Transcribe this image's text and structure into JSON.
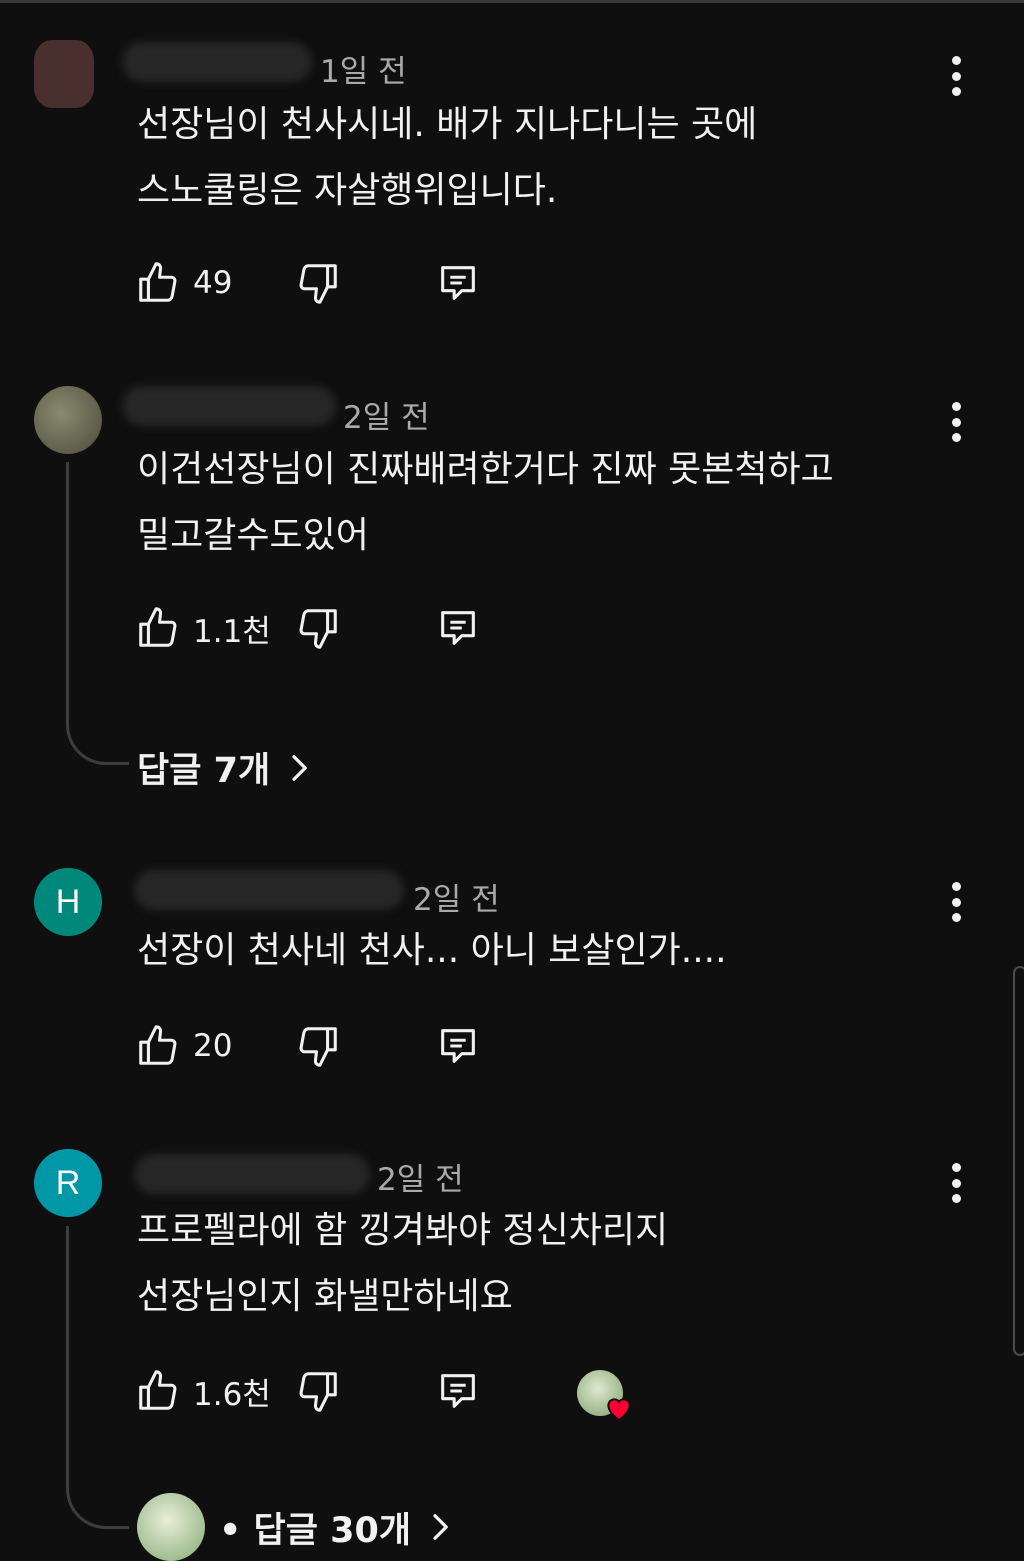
{
  "comments": [
    {
      "time": "1일 전",
      "text": "선장님이 천사시네. 배가 지나다니는 곳에\n스노쿨링은 자살행위입니다.",
      "likes": "49",
      "avatar_initial": "",
      "avatar_color": "#5a3a3a"
    },
    {
      "time": "2일 전",
      "text": "이건선장님이 진짜배려한거다 진짜 못본척하고\n밀고갈수도있어",
      "likes": "1.1천",
      "avatar_initial": "",
      "avatar_color": "#6b6a58",
      "replies": "답글 7개"
    },
    {
      "time": "2일 전",
      "text": "선장이 천사네 천사... 아니 보살인가....",
      "likes": "20",
      "avatar_initial": "H",
      "avatar_color": "#00897b"
    },
    {
      "time": "2일 전",
      "text": "프로펠라에 함 낑겨봐야 정신차리지\n선장님인지 화낼만하네요",
      "likes": "1.6천",
      "avatar_initial": "R",
      "avatar_color": "#0097a7",
      "replies": "• 답글 30개"
    }
  ],
  "colors": {
    "background": "#0f0f0f",
    "text": "#f1f1f1",
    "meta": "#aaaaaa",
    "heart": "#ff0033"
  },
  "icons": [
    "thumb-up-icon",
    "thumb-down-icon",
    "reply-comment-icon",
    "more-vert-icon",
    "chevron-right-icon",
    "heart-icon"
  ]
}
